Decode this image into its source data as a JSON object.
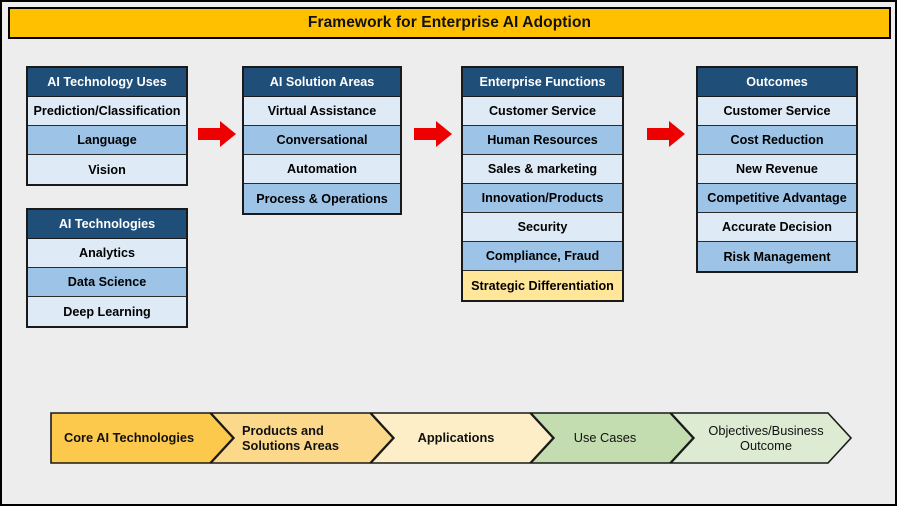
{
  "title": "Framework for Enterprise AI Adoption",
  "columns": [
    {
      "id": "ai-technology-uses",
      "header": "AI Technology Uses",
      "rows": [
        {
          "label": "Prediction/Classification",
          "tone": "light"
        },
        {
          "label": "Language",
          "tone": "mid"
        },
        {
          "label": "Vision",
          "tone": "light"
        }
      ]
    },
    {
      "id": "ai-technologies",
      "header": "AI Technologies",
      "rows": [
        {
          "label": "Analytics",
          "tone": "light"
        },
        {
          "label": "Data Science",
          "tone": "mid"
        },
        {
          "label": "Deep Learning",
          "tone": "light"
        }
      ]
    },
    {
      "id": "ai-solution-areas",
      "header": "AI Solution Areas",
      "rows": [
        {
          "label": "Virtual Assistance",
          "tone": "light"
        },
        {
          "label": "Conversational",
          "tone": "mid"
        },
        {
          "label": "Automation",
          "tone": "light"
        },
        {
          "label": "Process & Operations",
          "tone": "mid"
        }
      ]
    },
    {
      "id": "enterprise-functions",
      "header": "Enterprise Functions",
      "rows": [
        {
          "label": "Customer Service",
          "tone": "light"
        },
        {
          "label": "Human Resources",
          "tone": "mid"
        },
        {
          "label": "Sales & marketing",
          "tone": "light"
        },
        {
          "label": "Innovation/Products",
          "tone": "mid"
        },
        {
          "label": "Security",
          "tone": "light"
        },
        {
          "label": "Compliance, Fraud",
          "tone": "mid"
        },
        {
          "label": "Strategic Differentiation",
          "tone": "gold"
        }
      ]
    },
    {
      "id": "outcomes",
      "header": "Outcomes",
      "rows": [
        {
          "label": "Customer Service",
          "tone": "light"
        },
        {
          "label": "Cost Reduction",
          "tone": "mid"
        },
        {
          "label": "New Revenue",
          "tone": "light"
        },
        {
          "label": "Competitive Advantage",
          "tone": "mid"
        },
        {
          "label": "Accurate Decision",
          "tone": "light"
        },
        {
          "label": "Risk Management",
          "tone": "mid"
        }
      ]
    }
  ],
  "arrows": [
    {
      "id": "arrow-1"
    },
    {
      "id": "arrow-2"
    },
    {
      "id": "arrow-3"
    }
  ],
  "ribbon": [
    {
      "label": "Core AI Technologies",
      "color": "#fcc94d",
      "align": "left",
      "bold": true
    },
    {
      "label": "Products and Solutions Areas",
      "color": "#fbd88a",
      "align": "left",
      "bold": true
    },
    {
      "label": "Applications",
      "color": "#fdeec8",
      "align": "center",
      "bold": true
    },
    {
      "label": "Use Cases",
      "color": "#c3dcb0",
      "align": "center",
      "bold": false
    },
    {
      "label": "Objectives/Business Outcome",
      "color": "#ddebd3",
      "align": "center",
      "bold": false
    }
  ],
  "colors": {
    "title_bar": "#ffc000",
    "header_navy": "#1f4e79",
    "row_light": "#deeaf6",
    "row_mid": "#9dc3e6",
    "row_gold": "#ffe699",
    "arrow_red": "#ee0000",
    "background": "#ededed"
  }
}
